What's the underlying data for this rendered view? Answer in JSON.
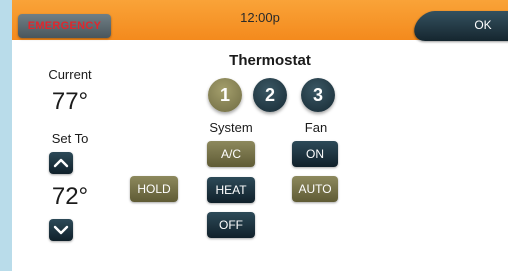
{
  "topbar": {
    "emergency_label": "EMERGENCY",
    "time": "12:00p",
    "ok_label": "OK"
  },
  "thermostat": {
    "title": "Thermostat",
    "current_label": "Current",
    "current_temp": "77°",
    "set_to_label": "Set To",
    "set_temp": "72°",
    "hold_label": "HOLD",
    "zones": [
      "1",
      "2",
      "3"
    ],
    "selected_zone": "1",
    "system_label": "System",
    "system_modes": [
      "A/C",
      "HEAT",
      "OFF"
    ],
    "selected_system_mode": "A/C",
    "fan_label": "Fan",
    "fan_modes": [
      "ON",
      "AUTO"
    ],
    "selected_fan_mode": "AUTO"
  },
  "colors": {
    "topbar": "#f48a1d",
    "emergency_text": "#e0262d",
    "active_button": "#6f6b43",
    "idle_button": "#10202a",
    "side_border": "#b9dcea"
  },
  "icons": {
    "up": "chevron-up-icon",
    "down": "chevron-down-icon"
  }
}
